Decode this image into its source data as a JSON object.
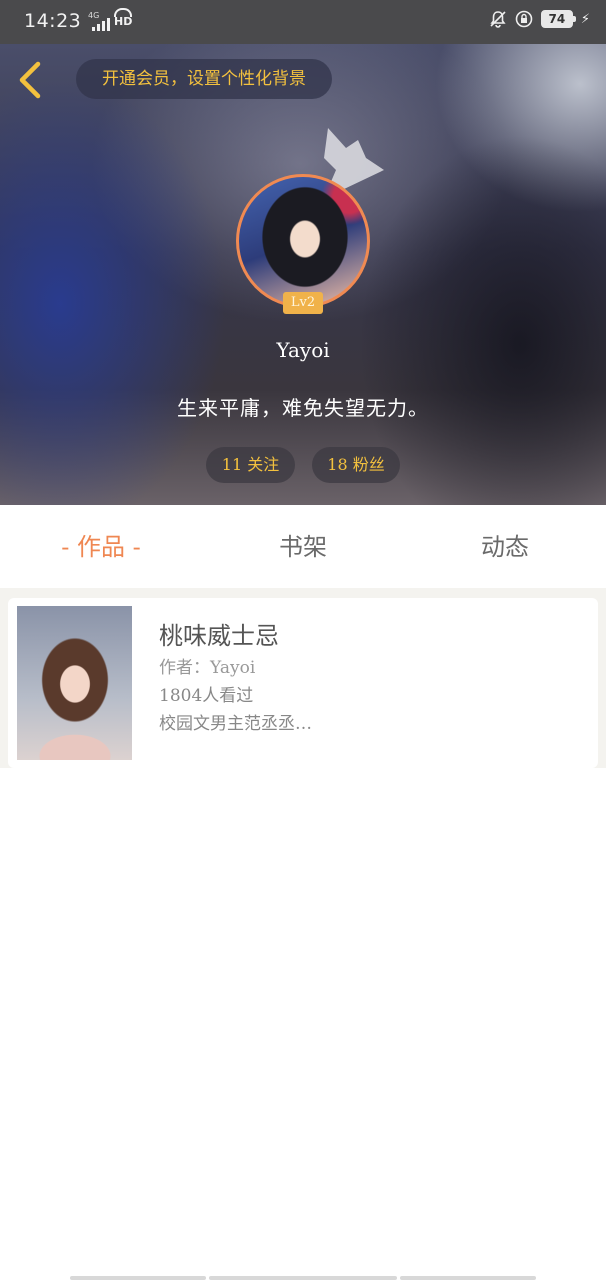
{
  "status_bar": {
    "time": "14:23",
    "network": "4G",
    "hd": "HD",
    "battery": "74"
  },
  "header": {
    "vip_banner": "开通会员，设置个性化背景",
    "level": "Lv2",
    "username": "Yayoi",
    "bio": "生来平庸，难免失望无力。",
    "following": "11 关注",
    "fans": "18 粉丝"
  },
  "tabs": [
    {
      "label": "- 作品 -",
      "active": true
    },
    {
      "label": "书架",
      "active": false
    },
    {
      "label": "动态",
      "active": false
    }
  ],
  "works": [
    {
      "title": "桃味威士忌",
      "author": "作者：Yayoi",
      "views": "1804人看过",
      "description": "校园文男主范丞丞…"
    }
  ],
  "colors": {
    "accent_orange": "#ef8752",
    "gold": "#f3c13e"
  }
}
